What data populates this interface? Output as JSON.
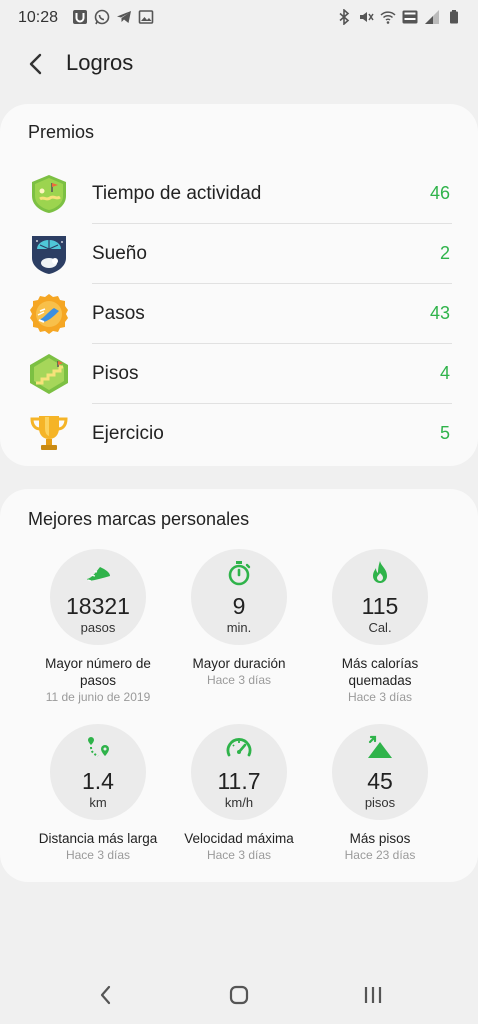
{
  "status_bar": {
    "time": "10:28",
    "left_icons": [
      "u-app-icon",
      "whatsapp-icon",
      "telegram-icon",
      "gallery-icon"
    ],
    "right_icons": [
      "bluetooth-icon",
      "mute-icon",
      "wifi-icon",
      "volte-icon",
      "signal-icon",
      "battery-icon"
    ]
  },
  "header": {
    "title": "Logros"
  },
  "premios": {
    "title": "Premios",
    "items": [
      {
        "label": "Tiempo de actividad",
        "count": "46",
        "icon": "activity-badge-icon"
      },
      {
        "label": "Sueño",
        "count": "2",
        "icon": "sleep-badge-icon"
      },
      {
        "label": "Pasos",
        "count": "43",
        "icon": "steps-badge-icon"
      },
      {
        "label": "Pisos",
        "count": "4",
        "icon": "floors-badge-icon"
      },
      {
        "label": "Ejercicio",
        "count": "5",
        "icon": "trophy-icon"
      }
    ]
  },
  "records": {
    "title": "Mejores marcas personales",
    "items": [
      {
        "value": "18321",
        "unit": "pasos",
        "label": "Mayor número de pasos",
        "date": "11 de junio de 2019",
        "icon": "shoe-icon"
      },
      {
        "value": "9",
        "unit": "min.",
        "label": "Mayor duración",
        "date": "Hace 3 días",
        "icon": "stopwatch-icon"
      },
      {
        "value": "115",
        "unit": "Cal.",
        "label": "Más calorías quemadas",
        "date": "Hace 3 días",
        "icon": "flame-icon"
      },
      {
        "value": "1.4",
        "unit": "km",
        "label": "Distancia más larga",
        "date": "Hace 3 días",
        "icon": "route-icon"
      },
      {
        "value": "11.7",
        "unit": "km/h",
        "label": "Velocidad máxima",
        "date": "Hace 3 días",
        "icon": "speedometer-icon"
      },
      {
        "value": "45",
        "unit": "pisos",
        "label": "Más pisos",
        "date": "Hace 23 días",
        "icon": "mountain-icon"
      }
    ]
  },
  "colors": {
    "accent": "#2fb34a",
    "background": "#f0f0f0",
    "card": "#fafafa"
  },
  "nav_bar": {
    "buttons": [
      "back-nav-icon",
      "home-nav-icon",
      "recents-nav-icon"
    ]
  }
}
